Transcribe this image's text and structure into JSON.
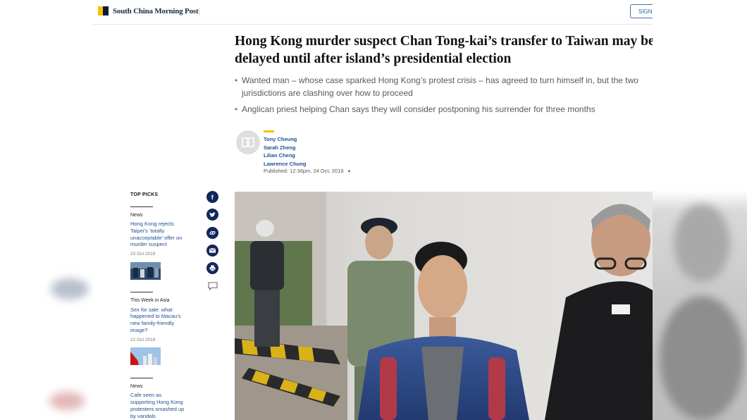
{
  "header": {
    "logo_text": "South China Morning Post",
    "sign_label": "SIGN"
  },
  "article": {
    "headline_line1": "Hong Kong murder suspect Chan Tong-kai’s transfer to Taiwan may be",
    "headline_line2": "delayed until after island’s presidential election",
    "bullets": [
      "Wanted man – whose case sparked Hong Kong’s protest crisis – has agreed to turn himself in, but the two jurisdictions are clashing over how to proceed",
      "Anglican priest helping Chan says they will consider postponing his surrender for three months"
    ],
    "authors": [
      "Tony Cheung",
      "Sarah Zheng",
      "Lilian Cheng",
      "Lawrence Chung"
    ],
    "published": "Published: 12:36pm, 24 Oct, 2019"
  },
  "top_picks": {
    "title": "TOP PICKS",
    "items": [
      {
        "category": "News",
        "headline": "Hong Kong rejects Taipei’s ‘totally unacceptable’ offer on murder suspect",
        "date": "23 Oct 2019"
      },
      {
        "category": "This Week in Asia",
        "headline": "Sex for sale: what happened to Macau’s new family-friendly image?",
        "date": "22 Oct 2019"
      },
      {
        "category": "News",
        "headline": "Cafe seen as supporting Hong Kong protesters smashed up by vandals",
        "date": ""
      }
    ]
  },
  "share": {
    "icons": [
      "facebook-icon",
      "twitter-icon",
      "link-icon",
      "email-icon",
      "print-icon",
      "comment-icon"
    ]
  },
  "colors": {
    "brand_yellow": "#f6c300",
    "brand_navy": "#0a1a3a",
    "link_blue": "#1f4f8f",
    "share_navy": "#13275a"
  }
}
